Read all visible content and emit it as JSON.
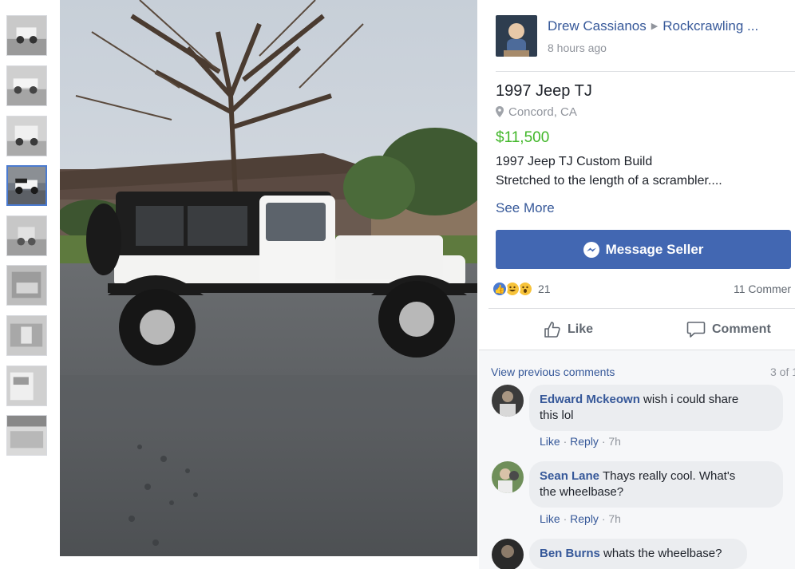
{
  "post": {
    "author": "Drew Cassianos",
    "group": "Rockcrawling ...",
    "time": "8 hours ago"
  },
  "listing": {
    "title": "1997 Jeep TJ",
    "location": "Concord, CA",
    "price": "$11,500",
    "description_line1": "1997 Jeep TJ Custom Build",
    "description_line2": "Stretched to the length of a scrambler....",
    "see_more": "See More"
  },
  "message_button": "Message Seller",
  "reactions": {
    "icons": [
      "like-icon",
      "haha-icon",
      "wow-icon"
    ],
    "count": "21",
    "comments_count": "11 Commer"
  },
  "actions": {
    "like": "Like",
    "comment": "Comment"
  },
  "comments": {
    "view_previous": "View previous comments",
    "count": "3 of 1",
    "items": [
      {
        "name": "Edward Mckeown",
        "text": "wish i could share",
        "text2": "this lol",
        "like": "Like",
        "reply": "Reply",
        "time": "7h"
      },
      {
        "name": "Sean Lane",
        "text": "Thays really cool. What's",
        "text2": "the wheelbase?",
        "like": "Like",
        "reply": "Reply",
        "time": "7h"
      },
      {
        "name": "Ben Burns",
        "text": "whats the wheelbase?"
      }
    ]
  },
  "colors": {
    "link": "#365899",
    "price": "#42b72a",
    "button": "#4267b2",
    "thumb_active_border": "#4b7bd0"
  }
}
